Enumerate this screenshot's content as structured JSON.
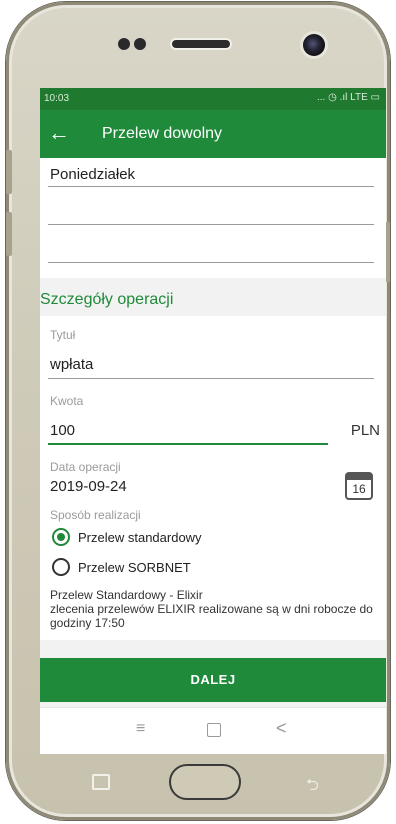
{
  "status_bar": {
    "time": "10:03",
    "icons_text": "... ◷ .ıl LTE ▭"
  },
  "app_bar": {
    "back_icon": "arrow-left-icon",
    "back_glyph": "←",
    "title": "Przelew dowolny"
  },
  "recipient_card": {
    "line1_value": "Poniedziałek"
  },
  "details": {
    "section_title": "Szczegóły operacji",
    "title_label": "Tytuł",
    "title_value": "wpłata",
    "amount_label": "Kwota",
    "amount_value": "100",
    "currency": "PLN",
    "date_label": "Data operacji",
    "date_value": "2019-09-24",
    "calendar_day": "16",
    "method_label": "Sposób realizacji",
    "options": [
      {
        "label": "Przelew standardowy",
        "selected": true
      },
      {
        "label": "Przelew SORBNET",
        "selected": false
      }
    ],
    "info_line1": "Przelew Standardowy - Elixir",
    "info_line2": "zlecenia przelewów ELIXIR realizowane są w dni robocze do godziny 17:50"
  },
  "primary_button": {
    "label": "DALEJ"
  },
  "nav": {
    "menu_glyph": "≡",
    "back_glyph": "<"
  },
  "colors": {
    "primary": "#1f8a3a",
    "status": "#1f7a30"
  }
}
